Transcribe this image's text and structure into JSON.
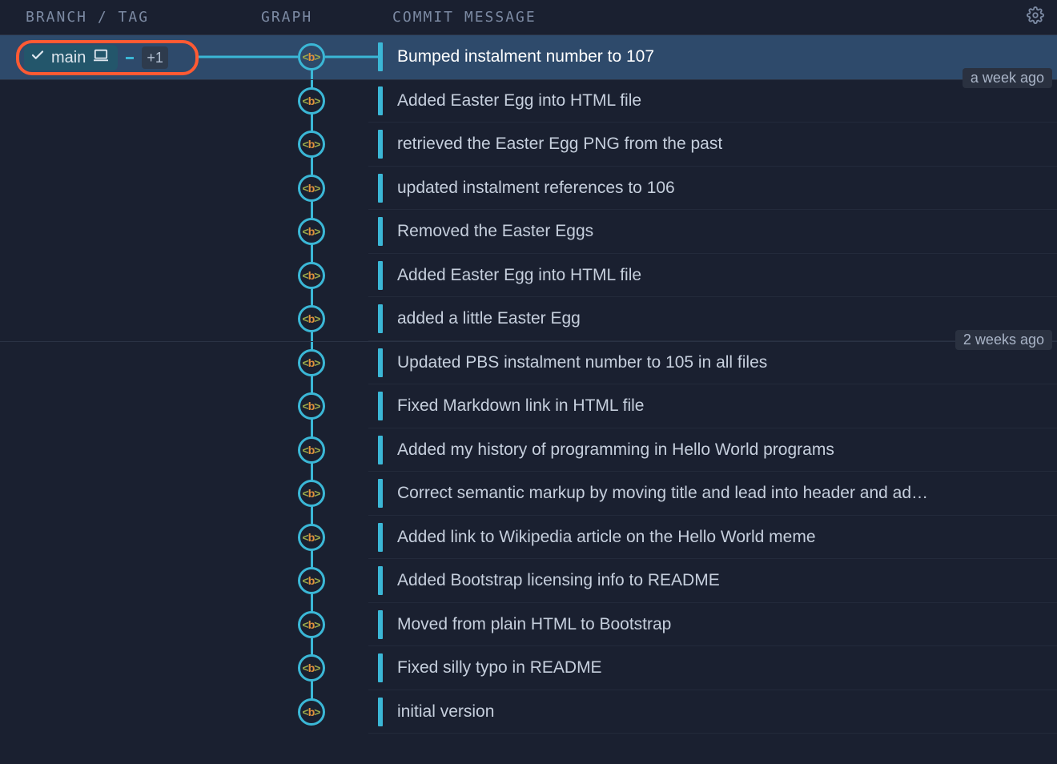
{
  "headers": {
    "branch": "BRANCH / TAG",
    "graph": "GRAPH",
    "commit": "COMMIT MESSAGE"
  },
  "branch_pill": {
    "name": "main",
    "extra": "+1"
  },
  "node_glyph": {
    "lt": "<",
    "b": "b",
    "gt": ">"
  },
  "time_groups": [
    {
      "label": "a week ago",
      "after_index": 0
    },
    {
      "label": "2 weeks ago",
      "after_index": 6
    }
  ],
  "commits": [
    {
      "msg": "Bumped instalment number to 107",
      "selected": true,
      "has_branch_pill": true,
      "first": true,
      "last": false
    },
    {
      "msg": "Added Easter Egg into HTML file",
      "selected": false,
      "has_branch_pill": false,
      "first": false,
      "last": false
    },
    {
      "msg": "retrieved the Easter Egg PNG from the past",
      "selected": false,
      "has_branch_pill": false,
      "first": false,
      "last": false
    },
    {
      "msg": "updated instalment references to 106",
      "selected": false,
      "has_branch_pill": false,
      "first": false,
      "last": false
    },
    {
      "msg": "Removed the Easter Eggs",
      "selected": false,
      "has_branch_pill": false,
      "first": false,
      "last": false
    },
    {
      "msg": "Added Easter Egg into HTML file",
      "selected": false,
      "has_branch_pill": false,
      "first": false,
      "last": false
    },
    {
      "msg": "added a little Easter Egg",
      "selected": false,
      "has_branch_pill": false,
      "first": false,
      "last": false
    },
    {
      "msg": "Updated PBS instalment number to 105 in all files",
      "selected": false,
      "has_branch_pill": false,
      "first": false,
      "last": false
    },
    {
      "msg": "Fixed Markdown link in HTML file",
      "selected": false,
      "has_branch_pill": false,
      "first": false,
      "last": false
    },
    {
      "msg": "Added my history of programming in Hello World programs",
      "selected": false,
      "has_branch_pill": false,
      "first": false,
      "last": false
    },
    {
      "msg": "Correct semantic markup by moving title and lead into header and ad…",
      "selected": false,
      "has_branch_pill": false,
      "first": false,
      "last": false
    },
    {
      "msg": "Added link to Wikipedia article on the Hello World meme",
      "selected": false,
      "has_branch_pill": false,
      "first": false,
      "last": false
    },
    {
      "msg": "Added Bootstrap licensing info to README",
      "selected": false,
      "has_branch_pill": false,
      "first": false,
      "last": false
    },
    {
      "msg": "Moved from plain HTML to Bootstrap",
      "selected": false,
      "has_branch_pill": false,
      "first": false,
      "last": false
    },
    {
      "msg": "Fixed silly typo in README",
      "selected": false,
      "has_branch_pill": false,
      "first": false,
      "last": false
    },
    {
      "msg": "initial version",
      "selected": false,
      "has_branch_pill": false,
      "first": false,
      "last": true
    }
  ]
}
